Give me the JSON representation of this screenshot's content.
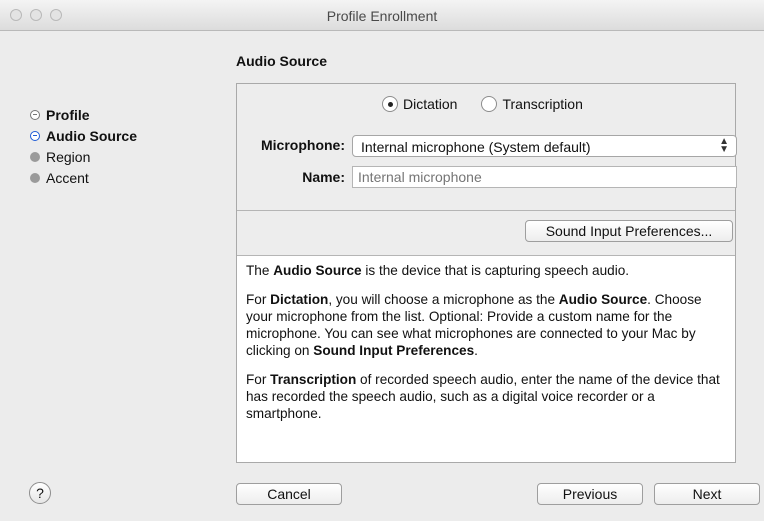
{
  "window": {
    "title": "Profile Enrollment"
  },
  "sidebar": {
    "steps": [
      {
        "label": "Profile",
        "state": "done"
      },
      {
        "label": "Audio Source",
        "state": "current"
      },
      {
        "label": "Region",
        "state": "todo"
      },
      {
        "label": "Accent",
        "state": "todo"
      }
    ]
  },
  "section": {
    "title": "Audio Source"
  },
  "mode": {
    "options": [
      "Dictation",
      "Transcription"
    ],
    "selected": "Dictation"
  },
  "microphone": {
    "label": "Microphone:",
    "value": "Internal microphone (System default)"
  },
  "name": {
    "label": "Name:",
    "placeholder": "Internal microphone"
  },
  "sound_prefs_button": "Sound Input Preferences...",
  "help": {
    "p1": {
      "pre": "The ",
      "b1": "Audio Source",
      "post": " is the device that is capturing speech audio."
    },
    "p2": {
      "pre": "For ",
      "b1": "Dictation",
      "mid1": ", you will choose a microphone as the ",
      "b2": "Audio Source",
      "mid2": ". Choose your microphone from the list. Optional: Provide a custom name for the microphone. You can see what microphones are connected to your Mac by clicking on ",
      "b3": "Sound Input Preferences",
      "post": "."
    },
    "p3": {
      "pre": "For ",
      "b1": "Transcription",
      "post": " of recorded speech audio, enter the name of the device that has recorded the speech audio, such as a digital voice recorder or a smartphone."
    }
  },
  "footer": {
    "help": "?",
    "cancel": "Cancel",
    "previous": "Previous",
    "next": "Next"
  },
  "colors": {
    "current_step": "#1e5bd6",
    "background": "#ececec"
  }
}
